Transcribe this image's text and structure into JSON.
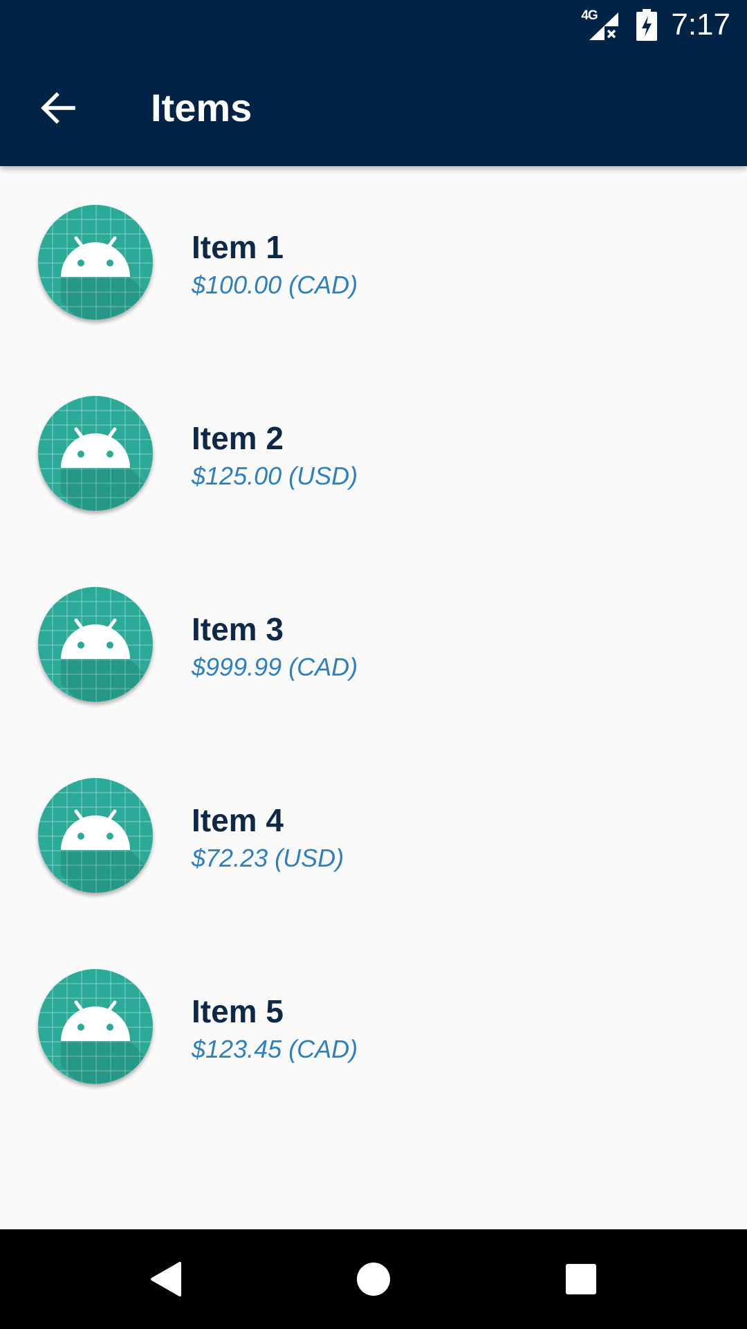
{
  "status_bar": {
    "network_label": "4G",
    "time": "7:17",
    "icons": [
      "signal-no-data-icon",
      "battery-charging-icon"
    ]
  },
  "app_bar": {
    "title": "Items",
    "back_icon": "arrow-back-icon"
  },
  "items": [
    {
      "name": "Item 1",
      "price": "$100.00 (CAD)"
    },
    {
      "name": "Item 2",
      "price": "$125.00 (USD)"
    },
    {
      "name": "Item 3",
      "price": "$999.99 (CAD)"
    },
    {
      "name": "Item 4",
      "price": "$72.23 (USD)"
    },
    {
      "name": "Item 5",
      "price": "$123.45 (CAD)"
    }
  ],
  "nav_bar": {
    "icons": [
      "nav-back-icon",
      "nav-home-icon",
      "nav-recents-icon"
    ]
  },
  "colors": {
    "app_bar": "#012346",
    "avatar": "#2baa98",
    "item_name": "#0e2847",
    "item_price": "#2c7fc0",
    "background": "#fafafa"
  }
}
